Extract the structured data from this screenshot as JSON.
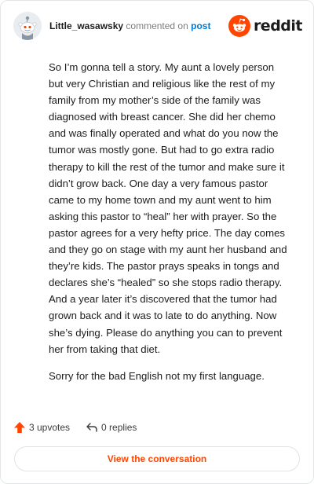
{
  "header": {
    "username": "Little_wasawsky",
    "byline_mid": "commented on",
    "byline_link": "post",
    "logo_text": "reddit"
  },
  "comment": {
    "paragraphs": [
      "So I’m gonna tell a story. My aunt a lovely person but very Christian and religious like the rest of my family from my mother’s side of the family was diagnosed with breast cancer. She did her chemo and was finally operated and what do you now the tumor was mostly gone. But had to go extra radio therapy to kill the rest of the tumor and make sure it didn’t grow back. One day a very famous pastor came to my home town and my aunt went to him asking this pastor to “heal” her with prayer. So the pastor agrees for a very hefty price. The day comes and they go on stage with my aunt her husband and they’re kids. The pastor prays speaks in tongs and declares she’s “healed” so she stops radio therapy. And a year later it’s discovered that the tumor had grown back and it was to late to do anything. Now she’s dying. Please do anything you can to prevent her from taking that diet.",
      "Sorry for the bad English not my first language."
    ]
  },
  "actions": {
    "upvotes": "3 upvotes",
    "replies": "0 replies"
  },
  "view_button": "View the conversation",
  "colors": {
    "accent": "#ff4500",
    "link": "#0079d3",
    "muted": "#7c7c7c"
  },
  "icons": {
    "upvote": "upvote-arrow-icon",
    "reply": "reply-arrow-icon",
    "logo": "reddit-snoo-icon"
  }
}
